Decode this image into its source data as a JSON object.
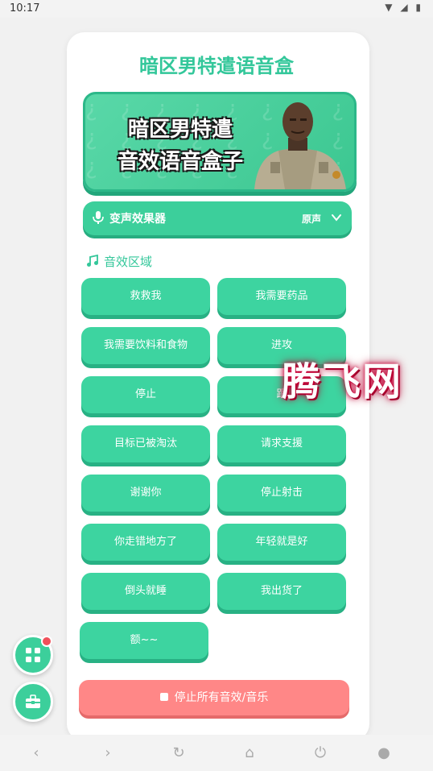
{
  "status_bar": {
    "time": "10:17"
  },
  "app": {
    "title": "暗区男特遣语音盒"
  },
  "banner": {
    "line1": "暗区男特遣",
    "line2": "音效语音盒子"
  },
  "voice_changer": {
    "label": "变声效果器",
    "value": "原声"
  },
  "sound_section": {
    "title": "音效区域"
  },
  "sounds": [
    "救救我",
    "我需要药品",
    "我需要饮料和食物",
    "进攻",
    "停止",
    "跟",
    "目标已被淘汰",
    "请求支援",
    "谢谢你",
    "停止射击",
    "你走错地方了",
    "年轻就是好",
    "倒头就睡",
    "我出货了",
    "额~~"
  ],
  "stop_all": {
    "label": "停止所有音效/音乐"
  },
  "watermark": {
    "text": "腾飞网"
  },
  "colors": {
    "accent": "#3ccf9b",
    "title": "#33c79a",
    "stop": "#ff8787"
  }
}
